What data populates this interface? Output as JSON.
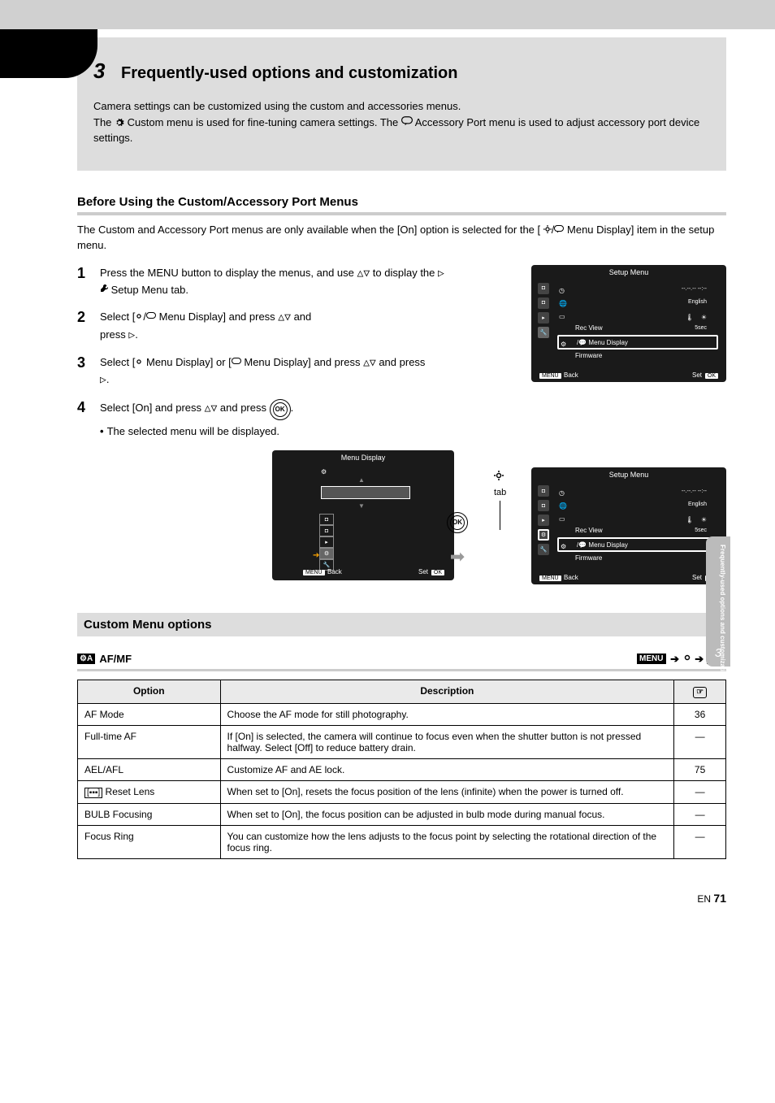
{
  "chapter_number": "3",
  "chapter_title": "Frequently-used options and customization",
  "intro_line1_a": "Camera settings can be customized using the custom and accessories menus.",
  "intro_line1_b": "The ",
  "intro_line1_c": " Custom menu is used for fine-tuning camera settings. The ",
  "intro_line1_d": " Accessory Port menu is used to adjust accessory port device settings.",
  "before_heading": "Before Using the Custom/Accessory Port Menus",
  "before_text_a": "The Custom and Accessory Port menus are only available when the [On] option is selected for the [",
  "before_text_b": " Menu Display] item in the setup menu.",
  "step1_a": "Press the MENU button to display the menus, and use ",
  "step1_b": " Setup Menu tab.",
  "step2_a": "Select [",
  "step2_b": " Menu Display] and press ",
  "step3_a": "Select [",
  "step3_b": " Menu Display] or [",
  "step3_c": " Menu Display] and press ",
  "step4_a": "Select [On] and press ",
  "step4_b": "The selected menu will be displayed.",
  "gear_label": " tab",
  "screen1": {
    "title": "Setup Menu",
    "rows": [
      {
        "icon": "clock",
        "label": "",
        "val": "--.--.-- --:--"
      },
      {
        "icon": "lang",
        "label": "",
        "val": "English"
      },
      {
        "icon": "monitor",
        "label": "",
        "val": ""
      },
      {
        "icon": "recview",
        "label": "Rec View",
        "val": "5sec"
      },
      {
        "icon": "gearbubble",
        "label": " Menu Display",
        "val": "",
        "hl": true
      },
      {
        "icon": "firmware",
        "label": "Firmware",
        "val": ""
      }
    ],
    "back": "Back",
    "menu": "MENU",
    "set": "Set",
    "ok": "OK"
  },
  "menubox": {
    "title": "Menu Display",
    "back": "Back",
    "menu": "MENU",
    "set": "Set",
    "ok": "OK"
  },
  "ok_btn": "OK",
  "menu_options_heading": "Custom Menu options",
  "tab_left_label": " AF/MF",
  "tab_right_label": "MENU",
  "table": {
    "headers": [
      "Option",
      "Description",
      ""
    ],
    "rows": [
      {
        "opt": "AF Mode",
        "desc": "Choose the AF mode for still photography.",
        "page": "36"
      },
      {
        "opt": "Full-time AF",
        "desc": "If [On] is selected, the camera will continue to focus even when the shutter button is not pressed halfway. Select [Off] to reduce battery drain.",
        "page": "—"
      },
      {
        "opt": "AEL/AFL",
        "desc": "Customize AF and AE lock.",
        "page": "75"
      },
      {
        "opt": "Reset Lens",
        "opt_extra": "",
        "desc": "When set to [On], resets the focus position of the lens (infinite) when the power is turned off.",
        "page": "—"
      },
      {
        "opt": "BULB Focusing",
        "desc": "When set to [On], the focus position can be adjusted in bulb mode during manual focus.",
        "page": "—"
      },
      {
        "opt": "Focus Ring",
        "desc": "You can customize how the lens adjusts to the focus point by selecting the rotational direction of the focus ring.",
        "page": "—"
      }
    ]
  },
  "footer_text": "EN",
  "footer_page": "71",
  "sidetab_text": "Frequently-used options and customization",
  "sidetab_num": "3"
}
